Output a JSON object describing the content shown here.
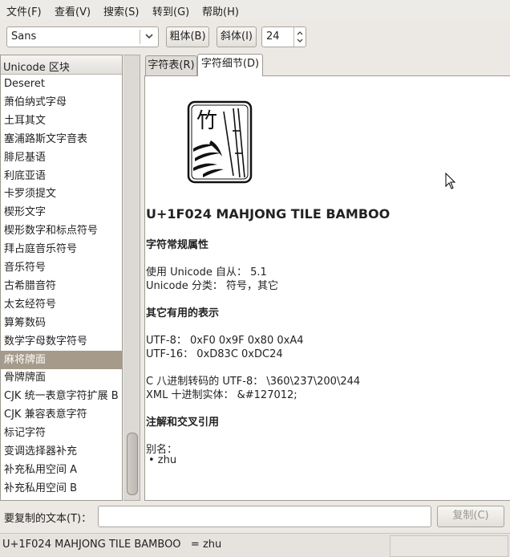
{
  "menubar": {
    "items": [
      "文件(F)",
      "查看(V)",
      "搜索(S)",
      "转到(G)",
      "帮助(H)"
    ]
  },
  "toolbar": {
    "font_value": "Sans",
    "bold_label": "粗体(B)",
    "italic_label": "斜体(I)",
    "size_value": "24"
  },
  "blocks_list": {
    "header": "Unicode 区块",
    "items": [
      "Deseret",
      "萧伯纳式字母",
      "土耳其文",
      "塞浦路斯文字音表",
      "腓尼基语",
      "利底亚语",
      "卡罗须提文",
      "楔形文字",
      "楔形数字和标点符号",
      "拜占庭音乐符号",
      "音乐符号",
      "古希腊音符",
      "太玄经符号",
      "算筹数码",
      "数学字母数字符号",
      "麻将牌面",
      "骨牌牌面",
      "CJK 统一表意字符扩展 B",
      "CJK 兼容表意字符",
      "标记字符",
      "变调选择器补充",
      "补充私用空间 A",
      "补充私用空间 B"
    ],
    "selected_index": 15
  },
  "tabs": {
    "table_label": "字符表(R)",
    "detail_label": "字符细节(D)"
  },
  "detail": {
    "glyph_char": "竹",
    "title": "U+1F024 MAHJONG TILE BAMBOO",
    "general_heading": "字符常规属性",
    "since": "使用 Unicode 自从： 5.1",
    "category": "Unicode 分类： 符号，其它",
    "other_heading": "其它有用的表示",
    "utf8": "UTF-8： 0xF0 0x9F 0x80 0xA4",
    "utf16": "UTF-16： 0xD83C 0xDC24",
    "c_octal": "C 八进制转码的 UTF-8： \\360\\237\\200\\244",
    "xml_entity": "XML 十进制实体： &#127012;",
    "notes_heading": "注解和交叉引用",
    "alias_label": "别名：",
    "alias_item": "• zhu"
  },
  "copy": {
    "label": "要复制的文本(T)：",
    "value": "",
    "button_label": "复制(C)"
  },
  "status": {
    "text": "U+1F024 MAHJONG TILE BAMBOO   = zhu"
  }
}
